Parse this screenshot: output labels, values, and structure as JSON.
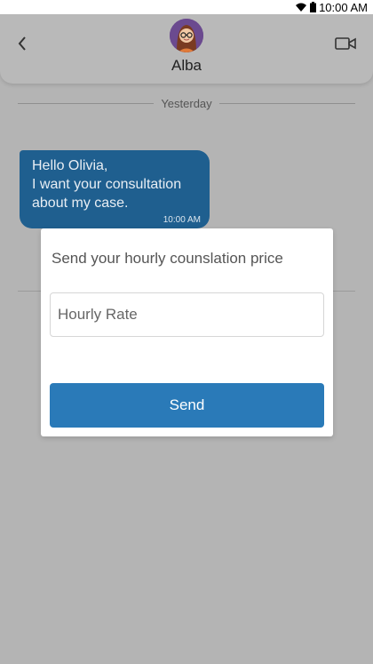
{
  "status_bar": {
    "time": "10:00 AM",
    "icons": [
      "wifi-icon",
      "battery-icon"
    ]
  },
  "header": {
    "contact_name": "Alba",
    "back_icon": "chevron-left-icon",
    "video_icon": "video-call-icon"
  },
  "chat": {
    "date_separator": "Yesterday",
    "messages": [
      {
        "text": "Hello Olivia,\nI want your consultation about my case.",
        "time": "10:00 AM",
        "direction": "incoming"
      }
    ]
  },
  "dialog": {
    "title": "Send your hourly counslation price",
    "input_placeholder": "Hourly Rate",
    "input_value": "",
    "send_label": "Send"
  },
  "colors": {
    "bubble": "#1f5f8f",
    "send_button": "#2a7ab8",
    "overlay": "#b4b4b4"
  }
}
